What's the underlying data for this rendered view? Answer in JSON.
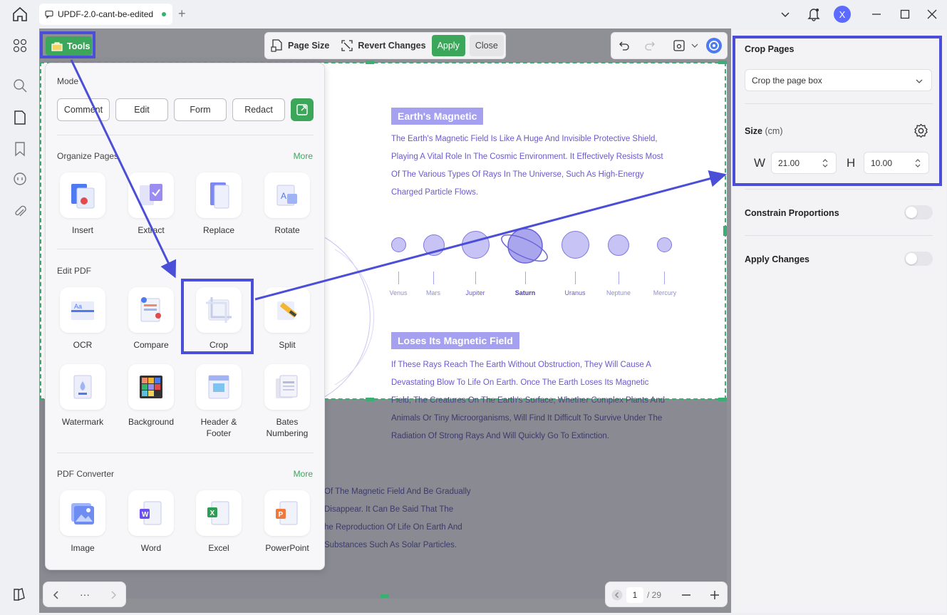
{
  "titlebar": {
    "tab_title": "UPDF-2.0-cant-be-edited",
    "avatar_letter": "X"
  },
  "toolbar": {
    "page_size": "Page Size",
    "revert": "Revert Changes",
    "apply": "Apply",
    "close": "Close"
  },
  "tools_button": "Tools",
  "tools_panel": {
    "mode": {
      "title": "Mode",
      "buttons": [
        "Comment",
        "Edit",
        "Form",
        "Redact"
      ]
    },
    "organize": {
      "title": "Organize Pages",
      "more": "More",
      "items": [
        "Insert",
        "Extract",
        "Replace",
        "Rotate"
      ]
    },
    "edit": {
      "title": "Edit PDF",
      "items": [
        "OCR",
        "Compare",
        "Crop",
        "Split",
        "Watermark",
        "Background",
        "Header &",
        "Footer",
        "Bates",
        "Numbering"
      ]
    },
    "converter": {
      "title": "PDF Converter",
      "more": "More",
      "items": [
        "Image",
        "Word",
        "Excel",
        "PowerPoint"
      ]
    }
  },
  "document": {
    "heading1": "Earth's Magnetic",
    "para1": [
      "The Earth's Magnetic Field Is Like A Huge And Invisible Protective Shield,",
      "Playing A Vital Role In The Cosmic Environment. It Effectively Resists Most",
      "Of The Various Types Of Rays In The Universe, Such As High-Energy",
      "Charged Particle Flows."
    ],
    "planets": [
      "Venus",
      "Mars",
      "Jupiter",
      "Saturn",
      "Uranus",
      "Neptune",
      "Mercury"
    ],
    "heading2": "Loses Its Magnetic Field",
    "para2": [
      "If These Rays Reach The Earth Without Obstruction, They Will Cause A",
      "Devastating Blow To Life On Earth. Once The Earth Loses Its Magnetic",
      "Field, The Creatures On The Earth's Surface, Whether Complex Plants And",
      "Animals Or Tiny Microorganisms, Will Find It Difficult To Survive Under The",
      "Radiation Of Strong Rays And Will Quickly Go To Extinction."
    ],
    "para3": [
      "Of The Magnetic Field And Be Gradually",
      "Disappear. It Can Be Said That The",
      "he Reproduction Of Life On Earth And",
      "Substances Such As Solar Particles."
    ]
  },
  "pagination": {
    "current": "1",
    "total": "/ 29",
    "dots": "···"
  },
  "right_panel": {
    "title": "Crop Pages",
    "select_value": "Crop the page box",
    "size_label": "Size",
    "size_unit": "(cm)",
    "w_label": "W",
    "w_value": "21.00",
    "h_label": "H",
    "h_value": "10.00",
    "constrain": "Constrain Proportions",
    "apply_changes": "Apply Changes"
  },
  "colors": {
    "accent_green": "#3ca65b",
    "highlight_blue": "#4b4ed6",
    "doc_purple": "#6a5acd"
  }
}
